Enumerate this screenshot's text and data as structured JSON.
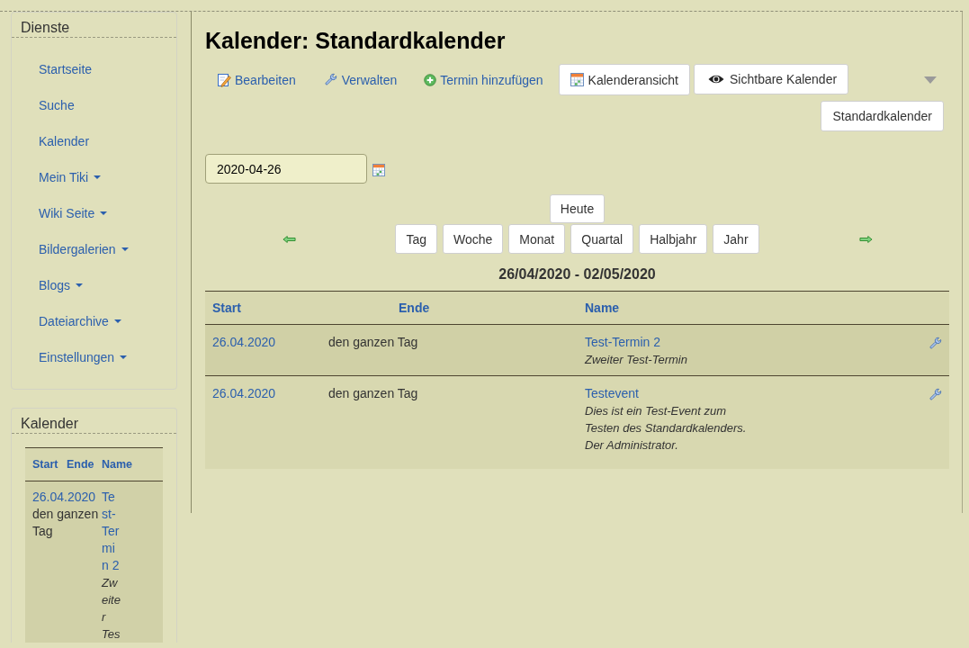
{
  "sidebar": {
    "services_module": {
      "title": "Dienste",
      "items": [
        {
          "label": "Startseite",
          "has_submenu": false
        },
        {
          "label": "Suche",
          "has_submenu": false
        },
        {
          "label": "Kalender",
          "has_submenu": false
        },
        {
          "label": "Mein Tiki",
          "has_submenu": true
        },
        {
          "label": "Wiki Seite",
          "has_submenu": true
        },
        {
          "label": "Bildergalerien",
          "has_submenu": true
        },
        {
          "label": "Blogs",
          "has_submenu": true
        },
        {
          "label": "Dateiarchive",
          "has_submenu": true
        },
        {
          "label": "Einstellungen",
          "has_submenu": true
        }
      ]
    },
    "calendar_module": {
      "title": "Kalender",
      "columns": [
        "Start",
        "Ende",
        "Name"
      ],
      "rows": [
        {
          "start": "26.04.2020",
          "end": "den ganzen Tag",
          "name": "Test-Termin 2",
          "description": "Zweiter Tes"
        }
      ]
    }
  },
  "main": {
    "title": "Kalender: Standardkalender",
    "actions": [
      {
        "kind": "edit",
        "label": "Bearbeiten"
      },
      {
        "kind": "manage",
        "label": "Verwalten"
      },
      {
        "kind": "add",
        "label": "Termin hinzufügen"
      },
      {
        "kind": "view",
        "label": "Kalenderansicht"
      },
      {
        "kind": "visible",
        "label": "Sichtbare Kalender"
      }
    ],
    "calendar_filter": "Standardkalender",
    "date_field": {
      "value": "2020-04-26"
    },
    "today_button": "Heute",
    "view_buttons": [
      "Tag",
      "Woche",
      "Monat",
      "Quartal",
      "Halbjahr",
      "Jahr"
    ],
    "range_title": "26/04/2020 - 02/05/2020",
    "events_table": {
      "columns": [
        "Start",
        "Ende",
        "Name"
      ],
      "rows": [
        {
          "start": "26.04.2020",
          "end": "den ganzen Tag",
          "name": "Test-Termin 2",
          "description": "Zweiter Test-Termin"
        },
        {
          "start": "26.04.2020",
          "end": "den ganzen Tag",
          "name": "Testevent",
          "description": "Dies ist ein Test-Event zum\nTesten des Standardkalenders.\nDer Administrator."
        }
      ]
    }
  }
}
